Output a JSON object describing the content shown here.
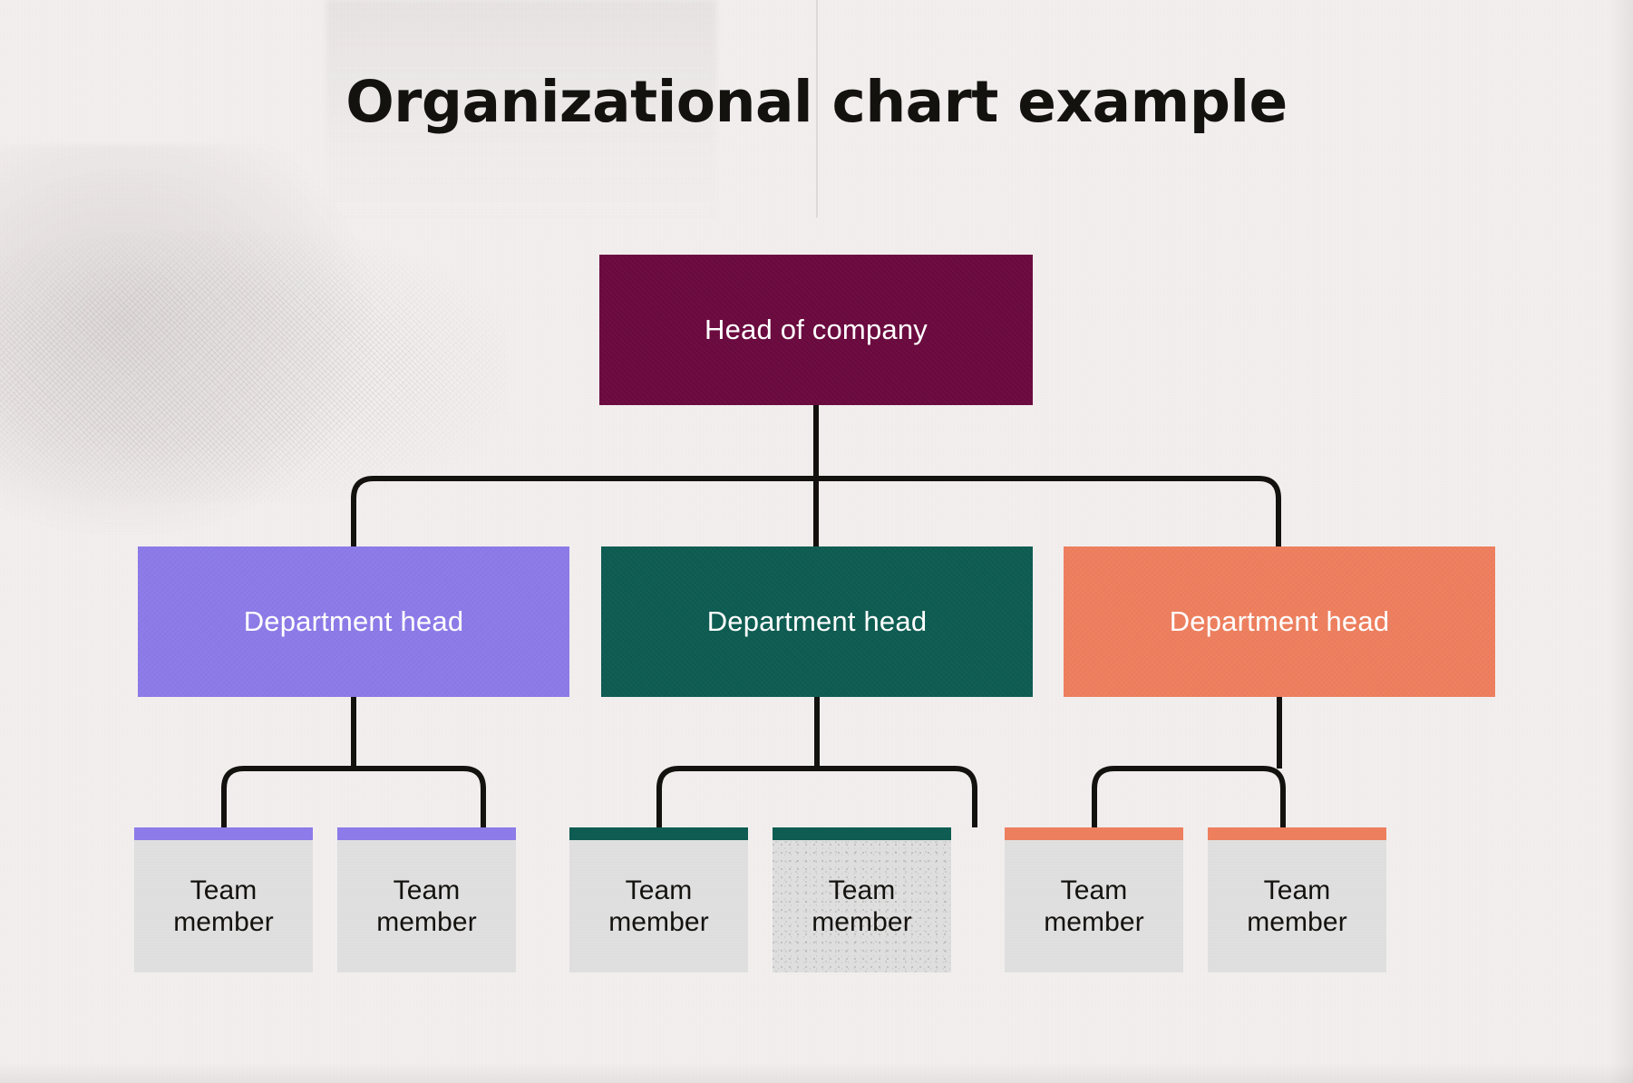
{
  "page": {
    "title": "Organizational chart example",
    "background_color": "#f2eeee"
  },
  "chart_data": {
    "type": "diagram",
    "diagram_type": "organizational-chart",
    "title": "Organizational chart example",
    "orientation": "top-down",
    "levels": 3,
    "colors": {
      "root": "#6b0a3f",
      "department_1": "#8c7be8",
      "department_2": "#0e5c52",
      "department_3": "#ee7f5e",
      "member_body": "#dedede",
      "connector": "#14120f",
      "background": "#f2eeee",
      "text_on_color": "#ffffff",
      "text_on_light": "#14120f"
    },
    "nodes": [
      {
        "id": "root",
        "label": "Head of company",
        "level": 0,
        "color": "#6b0a3f",
        "parent": null
      },
      {
        "id": "dept-0",
        "label": "Department head",
        "level": 1,
        "color": "#8c7be8",
        "parent": "root"
      },
      {
        "id": "dept-1",
        "label": "Department head",
        "level": 1,
        "color": "#0e5c52",
        "parent": "root"
      },
      {
        "id": "dept-2",
        "label": "Department head",
        "level": 1,
        "color": "#ee7f5e",
        "parent": "root"
      },
      {
        "id": "member-0",
        "label": "Team member",
        "level": 2,
        "color": "#8c7be8",
        "parent": "dept-0"
      },
      {
        "id": "member-1",
        "label": "Team member",
        "level": 2,
        "color": "#8c7be8",
        "parent": "dept-0"
      },
      {
        "id": "member-2",
        "label": "Team member",
        "level": 2,
        "color": "#0e5c52",
        "parent": "dept-1"
      },
      {
        "id": "member-3",
        "label": "Team member",
        "level": 2,
        "color": "#0e5c52",
        "parent": "dept-1"
      },
      {
        "id": "member-4",
        "label": "Team member",
        "level": 2,
        "color": "#ee7f5e",
        "parent": "dept-2"
      },
      {
        "id": "member-5",
        "label": "Team member",
        "level": 2,
        "color": "#ee7f5e",
        "parent": "dept-2"
      }
    ],
    "edges": [
      {
        "from": "root",
        "to": "dept-0"
      },
      {
        "from": "root",
        "to": "dept-1"
      },
      {
        "from": "root",
        "to": "dept-2"
      },
      {
        "from": "dept-0",
        "to": "member-0"
      },
      {
        "from": "dept-0",
        "to": "member-1"
      },
      {
        "from": "dept-1",
        "to": "member-2"
      },
      {
        "from": "dept-1",
        "to": "member-3"
      },
      {
        "from": "dept-2",
        "to": "member-4"
      },
      {
        "from": "dept-2",
        "to": "member-5"
      }
    ]
  },
  "root_node": {
    "label": "Head of company"
  },
  "departments": [
    {
      "label": "Department head",
      "color": "#8c7be8"
    },
    {
      "label": "Department head",
      "color": "#0e5c52"
    },
    {
      "label": "Department head",
      "color": "#ee7f5e"
    }
  ],
  "members": [
    {
      "line1": "Team",
      "line2": "member",
      "accent": "#8c7be8"
    },
    {
      "line1": "Team",
      "line2": "member",
      "accent": "#8c7be8"
    },
    {
      "line1": "Team",
      "line2": "member",
      "accent": "#0e5c52"
    },
    {
      "line1": "Team",
      "line2": "member",
      "accent": "#0e5c52"
    },
    {
      "line1": "Team",
      "line2": "member",
      "accent": "#ee7f5e"
    },
    {
      "line1": "Team",
      "line2": "member",
      "accent": "#ee7f5e"
    }
  ]
}
